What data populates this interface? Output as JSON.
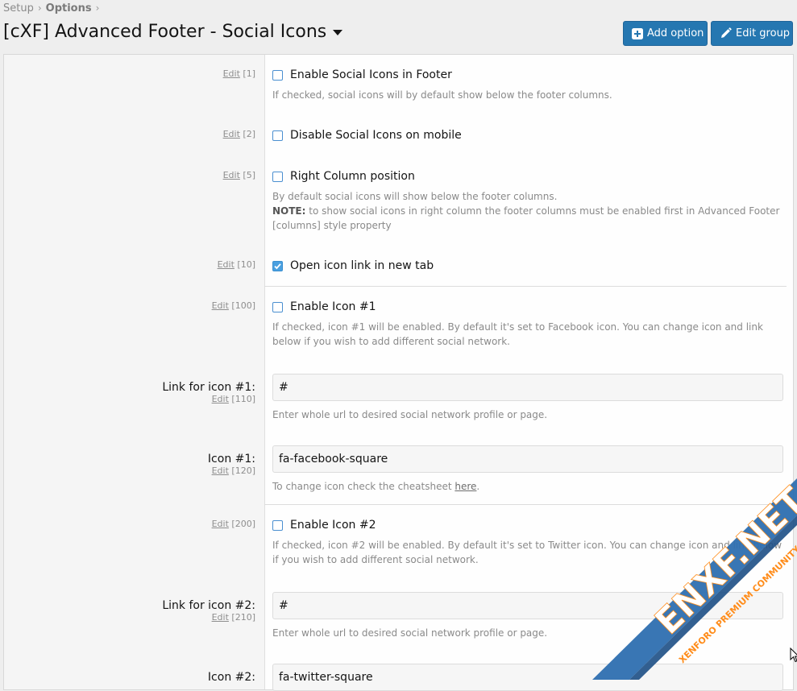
{
  "breadcrumb": {
    "items": [
      "Setup",
      "Options"
    ],
    "separator": "›"
  },
  "title": "[cXF] Advanced Footer - Social Icons",
  "buttons": {
    "add_option": "Add option",
    "edit_group": "Edit group"
  },
  "colors": {
    "primary_button": "#2577b1",
    "checkbox_checked": "#4aa0e0",
    "watermark": "#2e6fb0"
  },
  "edit_label": "Edit",
  "options": [
    {
      "order": "[1]",
      "label": "Enable Social Icons in Footer",
      "checked": false,
      "hint": "If checked, social icons will by default show below the footer columns."
    },
    {
      "order": "[2]",
      "label": "Disable Social Icons on mobile",
      "checked": false
    },
    {
      "order": "[5]",
      "label": "Right Column position",
      "checked": false,
      "hint_line1": "By default social icons will show below the footer columns.",
      "hint_note_label": "NOTE:",
      "hint_note_text": " to show social icons in right column the footer columns must be enabled first in Advanced Footer [columns] style property"
    },
    {
      "order": "[10]",
      "label": "Open icon link in new tab",
      "checked": true
    },
    {
      "order": "[100]",
      "label": "Enable Icon #1",
      "checked": false,
      "hint": "If checked, icon #1 will be enabled. By default it's set to Facebook icon. You can change icon and link below if you wish to add different social network."
    },
    {
      "order": "[110]",
      "field_label": "Link for icon #1:",
      "value": "#",
      "hint": "Enter whole url to desired social network profile or page."
    },
    {
      "order": "[120]",
      "field_label": "Icon #1:",
      "value": "fa-facebook-square",
      "hint_prefix": "To change icon check the cheatsheet ",
      "hint_link": "here",
      "hint_suffix": "."
    },
    {
      "order": "[200]",
      "label": "Enable Icon #2",
      "checked": false,
      "hint": "If checked, icon #2 will be enabled. By default it's set to Twitter icon. You can change icon and link below if you wish to add different social network."
    },
    {
      "order": "[210]",
      "field_label": "Link for icon #2:",
      "value": "#",
      "hint": "Enter whole url to desired social network profile or page."
    },
    {
      "field_label": "Icon #2:",
      "value": "fa-twitter-square"
    }
  ],
  "watermark": {
    "main": "ENXF.NET",
    "sub": "XENFORO PREMIUM COMMUNITY"
  }
}
